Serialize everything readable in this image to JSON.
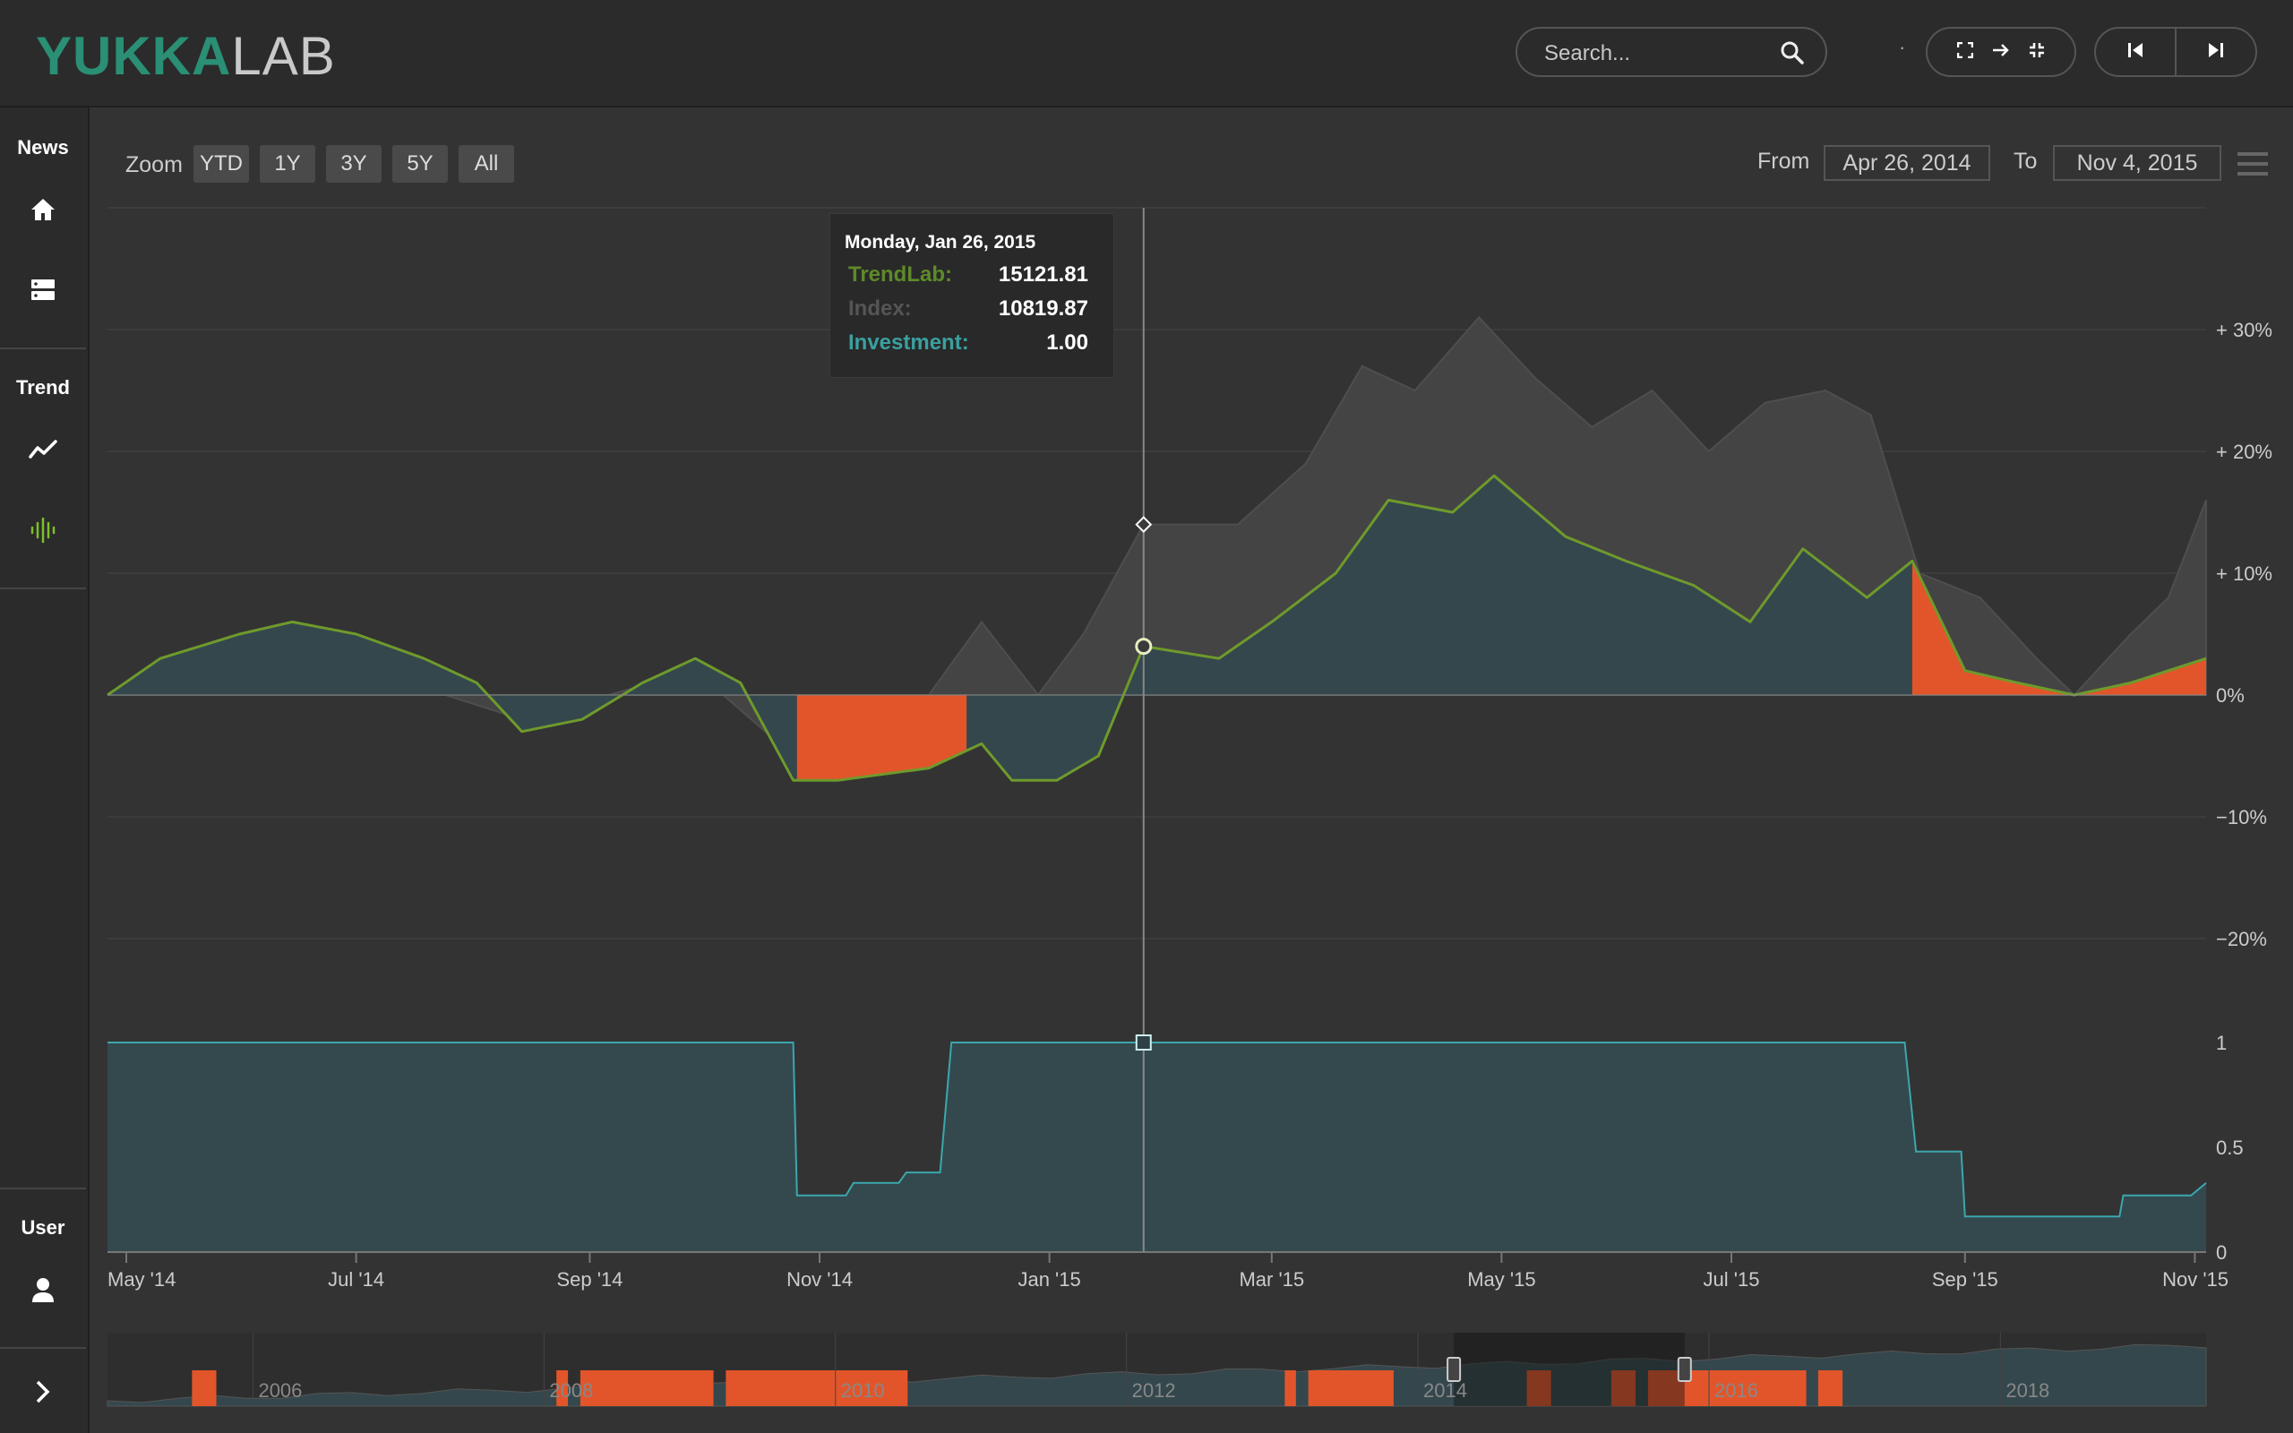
{
  "app": {
    "logo_part1": "YUKKA",
    "logo_part2": "LAB"
  },
  "header": {
    "search_placeholder": "Search...",
    "separator": "·",
    "icons": [
      "search-icon",
      "fullscreen-icon",
      "arrow-right-icon",
      "collapse-icon",
      "skip-back-icon",
      "skip-forward-icon"
    ]
  },
  "sidebar": {
    "sections": [
      {
        "label": "News",
        "items": [
          "home-icon",
          "server-icon"
        ]
      },
      {
        "label": "Trend",
        "items": [
          "trend-line-icon",
          "signal-wave-icon"
        ]
      },
      {
        "label": "User",
        "items": [
          "user-icon"
        ]
      }
    ],
    "expand_icon": "chevron-right-icon",
    "active_color": "#7cbf2a"
  },
  "controls": {
    "zoom_label": "Zoom",
    "zoom_buttons": [
      "YTD",
      "1Y",
      "3Y",
      "5Y",
      "All"
    ],
    "from_label": "From",
    "from_value": "Apr 26, 2014",
    "to_label": "To",
    "to_value": "Nov 4, 2015"
  },
  "tooltip": {
    "date": "Monday, Jan 26, 2015",
    "rows": [
      {
        "label": "TrendLab:",
        "value": "15121.81",
        "color": "#5e8a2a"
      },
      {
        "label": "Index:",
        "value": "10819.87",
        "color": "#555555"
      },
      {
        "label": "Investment:",
        "value": "1.00",
        "color": "#3aa0a0"
      }
    ]
  },
  "colors": {
    "trendlab_line": "#6e9a2c",
    "index_area": "#444444",
    "positive_fill": "#34474c",
    "negative_fill": "#e2552a",
    "investment_line": "#3ba7ad",
    "investment_fill": "#34494e",
    "grid": "#444444"
  },
  "chart_data": [
    {
      "type": "line",
      "title": "",
      "x_range": [
        "2014-04-26",
        "2015-11-04"
      ],
      "y_unit": "%",
      "y_ticks": [
        "+ 30%",
        "+ 20%",
        "+ 10%",
        "0%",
        "−10%",
        "−20%"
      ],
      "ylim": [
        -20,
        30
      ],
      "series": [
        {
          "name": "TrendLab",
          "points": [
            [
              "2014-04-26",
              0
            ],
            [
              "2014-05-10",
              3
            ],
            [
              "2014-05-31",
              5
            ],
            [
              "2014-06-14",
              6
            ],
            [
              "2014-07-01",
              5
            ],
            [
              "2014-07-19",
              3
            ],
            [
              "2014-08-02",
              1
            ],
            [
              "2014-08-14",
              -3
            ],
            [
              "2014-08-30",
              -2
            ],
            [
              "2014-09-15",
              1
            ],
            [
              "2014-09-29",
              3
            ],
            [
              "2014-10-11",
              1
            ],
            [
              "2014-10-25",
              -7
            ],
            [
              "2014-11-06",
              -7
            ],
            [
              "2014-11-30",
              -6
            ],
            [
              "2014-12-14",
              -4
            ],
            [
              "2014-12-22",
              -7
            ],
            [
              "2015-01-03",
              -7
            ],
            [
              "2015-01-14",
              -5
            ],
            [
              "2015-01-26",
              4
            ],
            [
              "2015-02-15",
              3
            ],
            [
              "2015-03-01",
              6
            ],
            [
              "2015-03-18",
              10
            ],
            [
              "2015-04-01",
              16
            ],
            [
              "2015-04-18",
              15
            ],
            [
              "2015-04-29",
              18
            ],
            [
              "2015-05-18",
              13
            ],
            [
              "2015-06-03",
              11
            ],
            [
              "2015-06-21",
              9
            ],
            [
              "2015-07-06",
              6
            ],
            [
              "2015-07-20",
              12
            ],
            [
              "2015-08-06",
              8
            ],
            [
              "2015-08-18",
              11
            ],
            [
              "2015-09-01",
              2
            ],
            [
              "2015-09-15",
              1
            ],
            [
              "2015-09-30",
              0
            ],
            [
              "2015-10-15",
              1
            ],
            [
              "2015-11-04",
              3
            ]
          ]
        },
        {
          "name": "Index",
          "points": [
            [
              "2014-04-26",
              0
            ],
            [
              "2014-06-14",
              4
            ],
            [
              "2014-08-14",
              -2
            ],
            [
              "2014-09-29",
              2
            ],
            [
              "2014-10-25",
              -5
            ],
            [
              "2014-11-30",
              0
            ],
            [
              "2014-12-14",
              6
            ],
            [
              "2014-12-29",
              0
            ],
            [
              "2015-01-10",
              5
            ],
            [
              "2015-01-26",
              14
            ],
            [
              "2015-02-20",
              14
            ],
            [
              "2015-03-10",
              19
            ],
            [
              "2015-03-25",
              27
            ],
            [
              "2015-04-08",
              25
            ],
            [
              "2015-04-25",
              31
            ],
            [
              "2015-05-10",
              26
            ],
            [
              "2015-05-25",
              22
            ],
            [
              "2015-06-10",
              25
            ],
            [
              "2015-06-25",
              20
            ],
            [
              "2015-07-10",
              24
            ],
            [
              "2015-07-26",
              25
            ],
            [
              "2015-08-07",
              23
            ],
            [
              "2015-08-20",
              10
            ],
            [
              "2015-09-05",
              8
            ],
            [
              "2015-09-20",
              3
            ],
            [
              "2015-09-30",
              0
            ],
            [
              "2015-10-15",
              5
            ],
            [
              "2015-10-25",
              8
            ],
            [
              "2015-11-04",
              16
            ]
          ]
        }
      ],
      "negative_bands": [
        [
          "2014-10-26",
          "2014-12-10"
        ],
        [
          "2015-08-18",
          "2015-11-04"
        ]
      ]
    },
    {
      "type": "area",
      "series_name": "Investment",
      "y_ticks": [
        "1",
        "0.5",
        "0"
      ],
      "ylim": [
        0,
        1
      ],
      "points": [
        [
          "2014-04-26",
          1
        ],
        [
          "2014-10-25",
          1
        ],
        [
          "2014-10-26",
          0.27
        ],
        [
          "2014-11-08",
          0.27
        ],
        [
          "2014-11-10",
          0.33
        ],
        [
          "2014-11-22",
          0.33
        ],
        [
          "2014-11-24",
          0.38
        ],
        [
          "2014-12-03",
          0.38
        ],
        [
          "2014-12-06",
          1
        ],
        [
          "2015-08-16",
          1
        ],
        [
          "2015-08-19",
          0.48
        ],
        [
          "2015-08-31",
          0.48
        ],
        [
          "2015-09-01",
          0.17
        ],
        [
          "2015-10-12",
          0.17
        ],
        [
          "2015-10-13",
          0.27
        ],
        [
          "2015-10-31",
          0.27
        ],
        [
          "2015-11-04",
          0.33
        ]
      ]
    }
  ],
  "x_axis": {
    "ticks": [
      "May '14",
      "Jul '14",
      "Sep '14",
      "Nov '14",
      "Jan '15",
      "Mar '15",
      "May '15",
      "Jul '15",
      "Sep '15",
      "Nov '15"
    ]
  },
  "navigator": {
    "ticks": [
      "2006",
      "2008",
      "2010",
      "2012",
      "2014",
      "2016",
      "2018"
    ],
    "negative_bands": [
      [
        "2005-08",
        "2005-10"
      ],
      [
        "2008-02",
        "2008-03"
      ],
      [
        "2008-04",
        "2009-03"
      ],
      [
        "2009-04",
        "2010-07"
      ],
      [
        "2013-02",
        "2013-03"
      ],
      [
        "2013-04",
        "2013-11"
      ],
      [
        "2014-10",
        "2014-12"
      ],
      [
        "2015-05",
        "2015-07"
      ],
      [
        "2015-08",
        "2016-09"
      ],
      [
        "2016-10",
        "2016-12"
      ]
    ]
  }
}
